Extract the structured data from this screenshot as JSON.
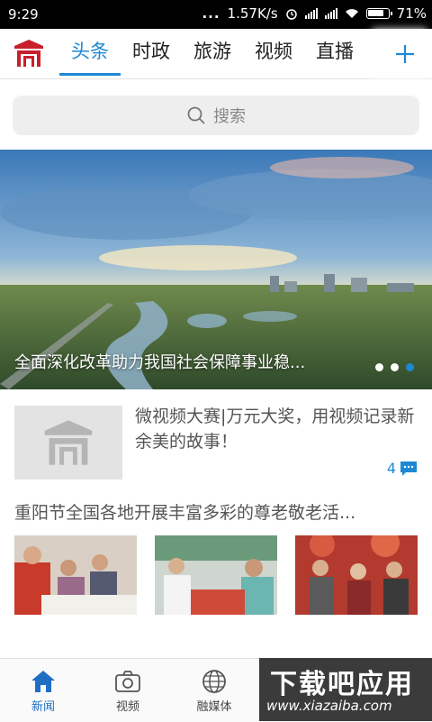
{
  "status_bar": {
    "time": "9:29",
    "dots": "...",
    "network_speed": "1.57K/s",
    "battery": "71%"
  },
  "tabs": [
    {
      "label": "头条",
      "active": true
    },
    {
      "label": "时政",
      "active": false
    },
    {
      "label": "旅游",
      "active": false
    },
    {
      "label": "视频",
      "active": false
    },
    {
      "label": "直播",
      "active": false
    }
  ],
  "add_tab_icon": "plus-icon",
  "search": {
    "placeholder": "搜索",
    "icon": "search-icon"
  },
  "banner": {
    "caption": "全面深化改革助力我国社会保障事业稳...",
    "slide_count": 3,
    "active_slide": 3
  },
  "news": [
    {
      "title": "微视频大赛|万元大奖，用视频记录新余美的故事！",
      "comments": "4"
    },
    {
      "title": "重阳节全国各地开展丰富多彩的尊老敬老活..."
    }
  ],
  "bottom_nav": [
    {
      "label": "新闻",
      "icon": "home-icon",
      "active": true
    },
    {
      "label": "视频",
      "icon": "camera-icon",
      "active": false
    },
    {
      "label": "融媒体",
      "icon": "globe-icon",
      "active": false
    }
  ],
  "watermark": {
    "title": "下载吧应用",
    "url": "www.xiazaiba.com"
  },
  "colors": {
    "accent": "#1e88d4",
    "text": "#555555",
    "status_bar": "#000000"
  }
}
